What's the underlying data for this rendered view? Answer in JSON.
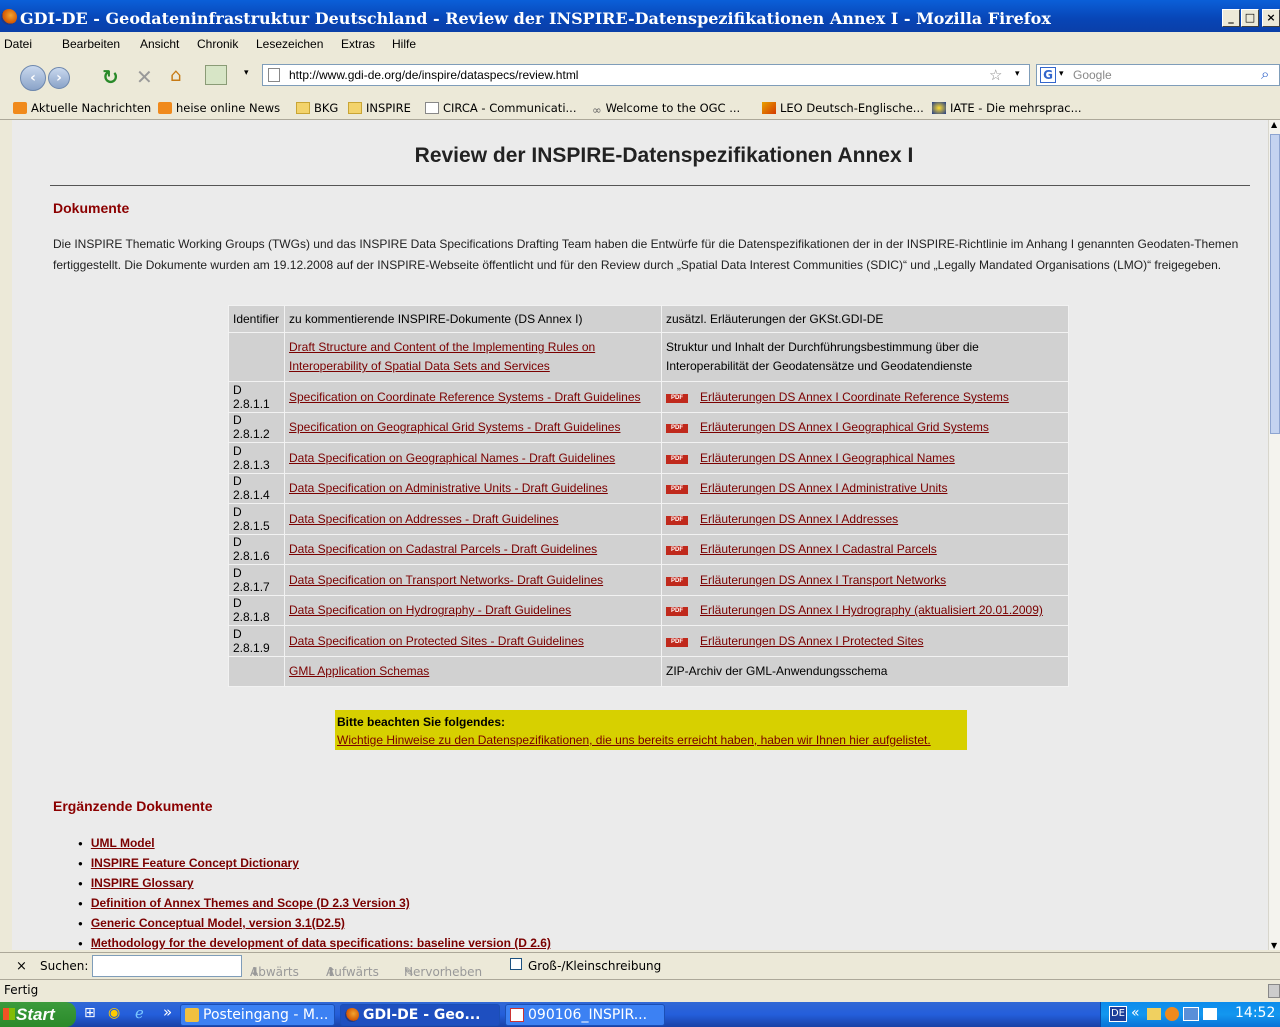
{
  "window": {
    "title": "GDI-DE - Geodateninfrastruktur Deutschland - Review der INSPIRE-Datenspezifikationen Annex I - Mozilla Firefox",
    "min": "_",
    "max": "□",
    "close": "×"
  },
  "menu": [
    "Datei",
    "Bearbeiten",
    "Ansicht",
    "Chronik",
    "Lesezeichen",
    "Extras",
    "Hilfe"
  ],
  "nav": {
    "url": "http://www.gdi-de.org/de/inspire/dataspecs/review.html",
    "search_placeholder": "Google",
    "search_engine": "G"
  },
  "bookmarks": [
    "Aktuelle Nachrichten",
    "heise online News",
    "BKG",
    "INSPIRE",
    "CIRCA - Communicati...",
    "Welcome to the OGC ...",
    "LEO Deutsch-Englische...",
    "IATE - Die mehrsprac..."
  ],
  "page": {
    "title": "Review der INSPIRE-Datenspezifikationen Annex I",
    "section1": "Dokumente",
    "intro": "Die INSPIRE Thematic Working Groups (TWGs) und das INSPIRE Data Specifications Drafting Team haben die Entwürfe für die Datenspezifikationen der in der INSPIRE-Richtlinie im Anhang I genannten Geodaten-Themen fertiggestellt. Die Dokumente wurden am 19.12.2008 auf der INSPIRE-Webseite öffentlicht und für den Review durch „Spatial Data Interest Communities (SDIC)“ und „Legally Mandated Organisations (LMO)“ freigegeben.",
    "table": {
      "headers": [
        "Identifier",
        "zu kommentierende INSPIRE-Dokumente (DS Annex I)",
        "zusätzl. Erläuterungen der GKSt.GDI-DE"
      ],
      "rows": [
        {
          "id": "",
          "doc": "Draft Structure and Content of the Implementing Rules on Interoperability of Spatial Data Sets and Services",
          "note": "Struktur und Inhalt der Durchführungsbestimmung über die Interoperabilität der Geodatensätze und Geodatendienste",
          "pdf": false
        },
        {
          "id": "D 2.8.1.1",
          "doc": "Specification on Coordinate Reference Systems - Draft Guidelines",
          "note": "Erläuterungen DS Annex I Coordinate Reference Systems",
          "pdf": true
        },
        {
          "id": "D 2.8.1.2",
          "doc": "Specification on Geographical Grid Systems - Draft Guidelines",
          "note": "Erläuterungen DS Annex I Geographical Grid Systems",
          "pdf": true
        },
        {
          "id": "D 2.8.1.3",
          "doc": "Data Specification on Geographical Names - Draft Guidelines",
          "note": "Erläuterungen DS Annex I Geographical Names",
          "pdf": true
        },
        {
          "id": "D 2.8.1.4",
          "doc": "Data Specification on Administrative Units - Draft Guidelines",
          "note": "Erläuterungen DS Annex I Administrative Units",
          "pdf": true
        },
        {
          "id": "D 2.8.1.5",
          "doc": "Data Specification on Addresses - Draft Guidelines",
          "note": "Erläuterungen DS Annex I Addresses",
          "pdf": true
        },
        {
          "id": "D 2.8.1.6",
          "doc": "Data Specification on Cadastral Parcels - Draft Guidelines",
          "note": "Erläuterungen DS Annex I Cadastral Parcels",
          "pdf": true
        },
        {
          "id": "D 2.8.1.7",
          "doc": "Data Specification on Transport Networks- Draft Guidelines",
          "note": "Erläuterungen DS Annex I Transport Networks",
          "pdf": true
        },
        {
          "id": "D 2.8.1.8",
          "doc": "Data Specification on Hydrography - Draft Guidelines",
          "note": "Erläuterungen DS Annex I Hydrography (aktualisiert 20.01.2009)",
          "pdf": true
        },
        {
          "id": "D 2.8.1.9",
          "doc": "Data Specification on Protected Sites - Draft Guidelines",
          "note": "Erläuterungen DS Annex I Protected Sites",
          "pdf": true
        },
        {
          "id": "",
          "doc": "GML Application Schemas",
          "note": "ZIP-Archiv der GML-Anwendungsschema",
          "pdf": false
        }
      ]
    },
    "pdf_label": "PDF",
    "note_title": "Bitte beachten Sie folgendes:",
    "note_link": "Wichtige Hinweise zu den Datenspezifikationen, die uns bereits erreicht haben, haben wir Ihnen hier aufgelistet.",
    "section2": "Ergänzende Dokumente",
    "extra": [
      "UML Model",
      "INSPIRE Feature Concept Dictionary",
      "INSPIRE Glossary",
      "Definition of Annex Themes and Scope (D 2.3 Version 3)",
      "Generic Conceptual Model, version 3.1(D2.5)",
      "Methodology for the development of data specifications: baseline version (D 2.6)"
    ]
  },
  "findbar": {
    "close": "×",
    "label": "Suchen:",
    "prev": "Abwärts",
    "next": "Aufwärts",
    "highlight": "Hervorheben",
    "case": "Groß-/Kleinschreibung"
  },
  "status": "Fertig",
  "taskbar": {
    "start": "Start",
    "chevron": "»",
    "tasks": [
      "Posteingang - M...",
      "GDI-DE - Geo...",
      "090106_INSPIR..."
    ],
    "lang": "DE",
    "tray_chevron": "«",
    "clock": "14:52"
  },
  "colors": {
    "link": "#7a0000",
    "note_bg": "#d7d000",
    "table_bg": "#d1d1d1",
    "titlebar": "#0a4fcb"
  }
}
